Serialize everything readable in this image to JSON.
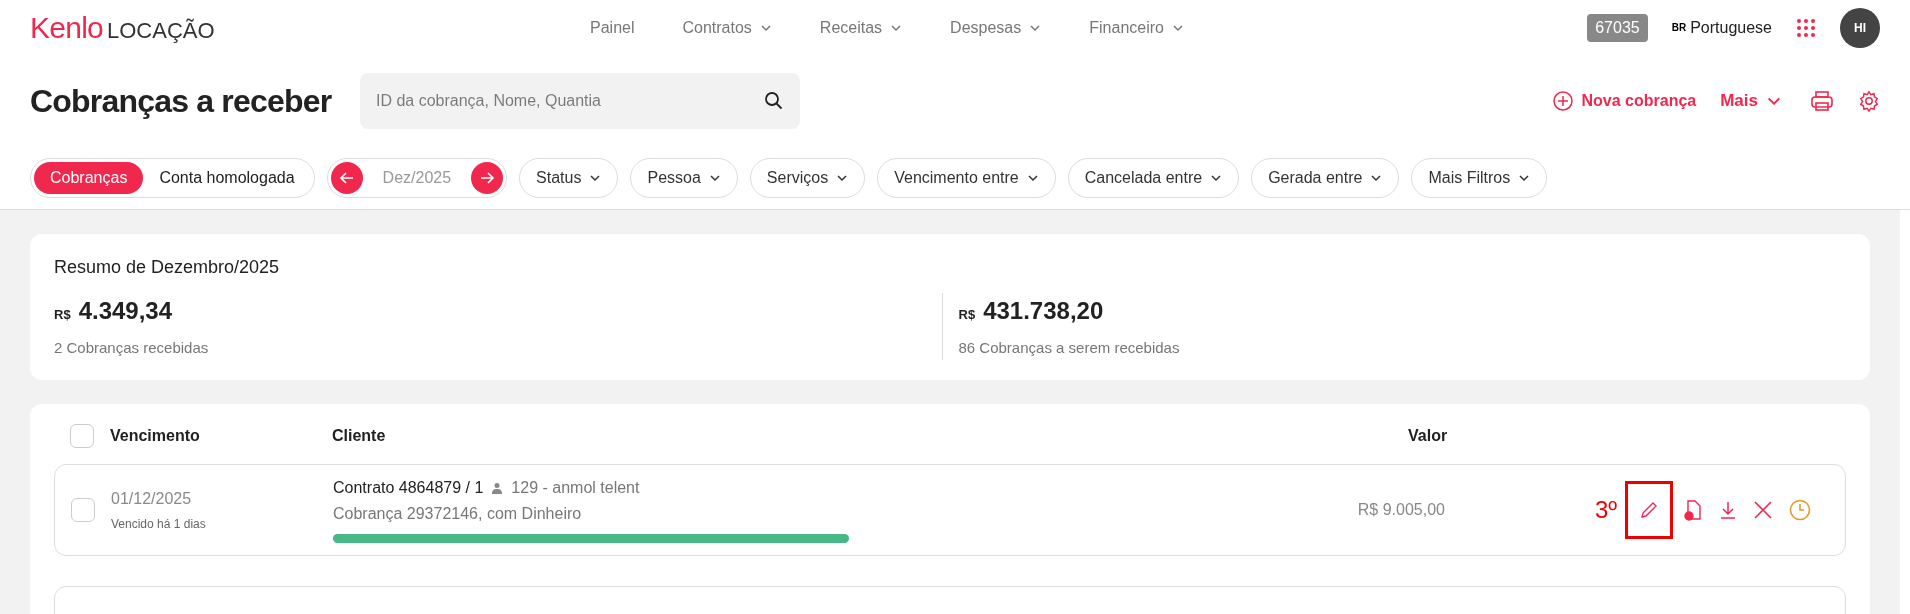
{
  "logo": {
    "brand": "Kenlo",
    "product": "LOCAÇÃO"
  },
  "nav": [
    {
      "label": "Painel",
      "dropdown": false
    },
    {
      "label": "Contratos",
      "dropdown": true
    },
    {
      "label": "Receitas",
      "dropdown": true
    },
    {
      "label": "Despesas",
      "dropdown": true
    },
    {
      "label": "Financeiro",
      "dropdown": true
    }
  ],
  "header_right": {
    "account_badge": "67035",
    "language_flag": "BR",
    "language": "Portuguese",
    "avatar": "HI"
  },
  "page_title": "Cobranças a receber",
  "search": {
    "placeholder": "ID da cobrança, Nome, Quantia"
  },
  "actions": {
    "new": "Nova cobrança",
    "more": "Mais"
  },
  "view_toggle": [
    {
      "label": "Cobranças",
      "selected": true
    },
    {
      "label": "Conta homologada",
      "selected": false
    }
  ],
  "month": "Dez/2025",
  "filters": [
    "Status",
    "Pessoa",
    "Serviços",
    "Vencimento entre",
    "Cancelada entre",
    "Gerada entre",
    "Mais Filtros"
  ],
  "summary": {
    "title": "Resumo de Dezembro/2025",
    "blocks": [
      {
        "currency": "R$",
        "amount": "4.349,34",
        "caption": "2 Cobranças recebidas"
      },
      {
        "currency": "R$",
        "amount": "431.738,20",
        "caption": "86 Cobranças a serem recebidas"
      }
    ]
  },
  "table": {
    "columns": [
      "Vencimento",
      "Cliente",
      "Valor"
    ],
    "select_all_checked": false,
    "rows": [
      {
        "checked": false,
        "date": "01/12/2025",
        "overdue": "Vencido há 1 dias",
        "contract": "Contrato 4864879 / 1",
        "person": "129 - anmol telent",
        "charge": "Cobrança 29372146, com Dinheiro",
        "level": 1,
        "value": "R$ 9.005,00",
        "annotation": "3º"
      }
    ]
  }
}
